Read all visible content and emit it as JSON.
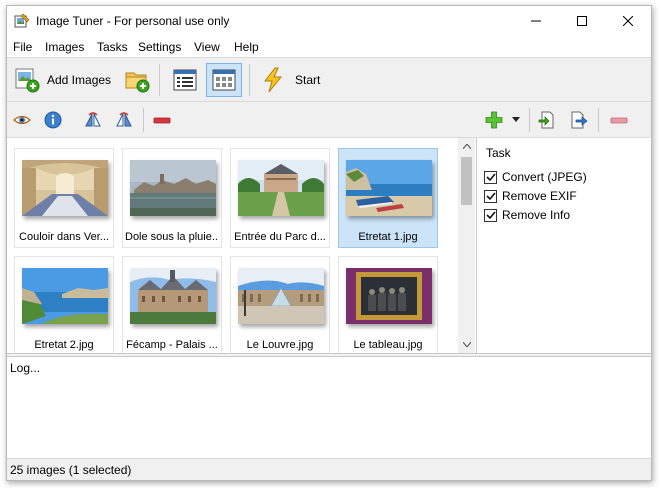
{
  "window": {
    "title": "Image Tuner - For personal use only"
  },
  "menu": [
    "File",
    "Images",
    "Tasks",
    "Settings",
    "View",
    "Help"
  ],
  "toolbar": {
    "add_images_label": "Add Images",
    "start_label": "Start"
  },
  "images": [
    {
      "label": "Couloir dans Ver...",
      "selected": false
    },
    {
      "label": "Dole sous la pluie...",
      "selected": false
    },
    {
      "label": "Entrée du Parc d...",
      "selected": false
    },
    {
      "label": "Etretat 1.jpg",
      "selected": true
    },
    {
      "label": "Etretat 2.jpg",
      "selected": false
    },
    {
      "label": "Fécamp - Palais ...",
      "selected": false
    },
    {
      "label": "Le Louvre.jpg",
      "selected": false
    },
    {
      "label": "Le tableau.jpg",
      "selected": false
    }
  ],
  "task_panel": {
    "header": "Task",
    "tasks": [
      {
        "label": "Convert (JPEG)",
        "checked": true
      },
      {
        "label": "Remove EXIF",
        "checked": true
      },
      {
        "label": "Remove Info",
        "checked": true
      }
    ]
  },
  "log": {
    "text": "Log..."
  },
  "status": {
    "text": "25 images (1 selected)"
  },
  "icons": {
    "app": "app-icon",
    "minimize": "minimize-icon",
    "maximize": "maximize-icon",
    "close": "close-icon",
    "add_images": "add-images-icon",
    "add_folder": "add-folder-icon",
    "list_view": "list-view-icon",
    "thumbnail_view": "thumbnail-view-icon",
    "start": "lightning-icon",
    "preview": "eye-icon",
    "info": "info-icon",
    "flip": "flip-icon",
    "rotate": "rotate-icon",
    "remove": "minus-icon",
    "add_task": "plus-icon",
    "dropdown": "dropdown-arrow-icon",
    "import_task": "import-icon",
    "export_task": "export-icon",
    "remove_task": "minus-icon"
  },
  "colors": {
    "selection": "#cce4f7",
    "selection_border": "#99c9ef",
    "toolbar_bg": "#f0f0f0",
    "accent_green": "#3aa51d",
    "remove_red": "#d9363e"
  }
}
